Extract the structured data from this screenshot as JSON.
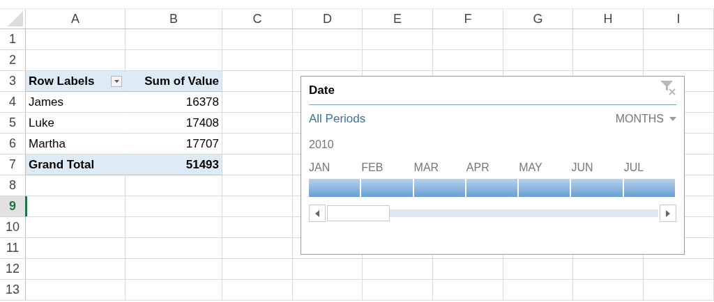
{
  "columns": [
    "A",
    "B",
    "C",
    "D",
    "E",
    "F",
    "G",
    "H",
    "I"
  ],
  "rows": [
    {
      "number": "1",
      "selected": false,
      "kind": "empty"
    },
    {
      "number": "2",
      "selected": false,
      "kind": "empty"
    },
    {
      "number": "3",
      "selected": false,
      "kind": "pivot-header",
      "cells": [
        "Row Labels",
        "Sum of Value"
      ]
    },
    {
      "number": "4",
      "selected": false,
      "kind": "pivot-item",
      "cells": [
        "James",
        "16378"
      ]
    },
    {
      "number": "5",
      "selected": false,
      "kind": "pivot-item",
      "cells": [
        "Luke",
        "17408"
      ]
    },
    {
      "number": "6",
      "selected": false,
      "kind": "pivot-item",
      "cells": [
        "Martha",
        "17707"
      ]
    },
    {
      "number": "7",
      "selected": false,
      "kind": "pivot-total",
      "cells": [
        "Grand Total",
        "51493"
      ]
    },
    {
      "number": "8",
      "selected": false,
      "kind": "empty"
    },
    {
      "number": "9",
      "selected": true,
      "kind": "empty"
    },
    {
      "number": "10",
      "selected": false,
      "kind": "empty"
    },
    {
      "number": "11",
      "selected": false,
      "kind": "empty"
    },
    {
      "number": "12",
      "selected": false,
      "kind": "empty"
    },
    {
      "number": "13",
      "selected": false,
      "kind": "empty"
    }
  ],
  "timeline": {
    "title": "Date",
    "clear_filter_disabled": true,
    "selection_label": "All Periods",
    "time_level": "MONTHS",
    "year": "2010",
    "months": [
      {
        "label": "JAN",
        "selected": true
      },
      {
        "label": "FEB",
        "selected": true
      },
      {
        "label": "MAR",
        "selected": true
      },
      {
        "label": "APR",
        "selected": true
      },
      {
        "label": "MAY",
        "selected": true
      },
      {
        "label": "JUN",
        "selected": true
      },
      {
        "label": "JUL",
        "selected": true
      }
    ]
  }
}
